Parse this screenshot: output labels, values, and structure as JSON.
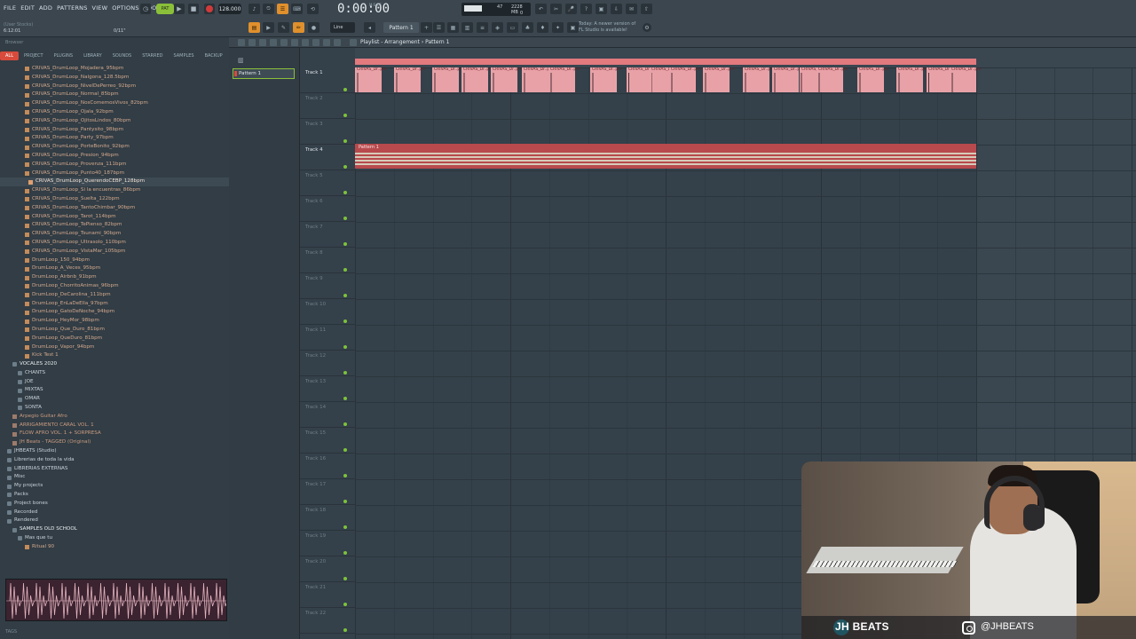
{
  "menu": [
    "FILE",
    "EDIT",
    "ADD",
    "PATTERNS",
    "VIEW",
    "OPTIONS",
    "TOOLS",
    "HELP"
  ],
  "hint": {
    "top": "(User Stocks)",
    "time": "6:12:01",
    "right": "0/11\""
  },
  "transport": {
    "pat_label": "PAT",
    "tempo": "128.000",
    "time": "0:00:00",
    "time_sub": "M:S:CS"
  },
  "cpu": {
    "ram": "2228 MB",
    "cpu": "47",
    "voices": "0"
  },
  "notice": [
    "Today:  A newer version of",
    "FL Studio is available!"
  ],
  "toolbar": {
    "snap": "Line",
    "pattern": "Pattern 1"
  },
  "browser": {
    "header": "Browser",
    "tabs": [
      "ALL",
      "PROJECT",
      "PLUGINS",
      "LIBRARY",
      "SOUNDS",
      "STARRED",
      "SAMPLES",
      "BACKUP"
    ],
    "items": [
      {
        "label": "CRIVAS_DrumLoop_Mojadera_95bpm",
        "kind": "file"
      },
      {
        "label": "CRIVAS_DrumLoop_Nalgona_128.5bpm",
        "kind": "file"
      },
      {
        "label": "CRIVAS_DrumLoop_NivelDePerreo_92bpm",
        "kind": "file"
      },
      {
        "label": "CRIVAS_DrumLoop_Normal_85bpm",
        "kind": "file"
      },
      {
        "label": "CRIVAS_DrumLoop_NosComemosVivos_82bpm",
        "kind": "file"
      },
      {
        "label": "CRIVAS_DrumLoop_Ojala_92bpm",
        "kind": "file"
      },
      {
        "label": "CRIVAS_DrumLoop_OjitosLindos_80bpm",
        "kind": "file"
      },
      {
        "label": "CRIVAS_DrumLoop_Pantysito_98bpm",
        "kind": "file"
      },
      {
        "label": "CRIVAS_DrumLoop_Party_97bpm",
        "kind": "file"
      },
      {
        "label": "CRIVAS_DrumLoop_PorteBonito_92bpm",
        "kind": "file"
      },
      {
        "label": "CRIVAS_DrumLoop_Presion_94bpm",
        "kind": "file"
      },
      {
        "label": "CRIVAS_DrumLoop_Provenza_111bpm",
        "kind": "file"
      },
      {
        "label": "CRIVAS_DrumLoop_Punto40_187bpm",
        "kind": "file"
      },
      {
        "label": "CRIVAS_DrumLoop_QuerendoCEBP_128bpm",
        "kind": "sel"
      },
      {
        "label": "CRIVAS_DrumLoop_Si la encuentras_86bpm",
        "kind": "file"
      },
      {
        "label": "CRIVAS_DrumLoop_Suelta_122bpm",
        "kind": "file"
      },
      {
        "label": "CRIVAS_DrumLoop_TantoChimbar_90bpm",
        "kind": "file"
      },
      {
        "label": "CRIVAS_DrumLoop_Tarot_114bpm",
        "kind": "file"
      },
      {
        "label": "CRIVAS_DrumLoop_TePienso_82bpm",
        "kind": "file"
      },
      {
        "label": "CRIVAS_DrumLoop_Tsunami_90bpm",
        "kind": "file"
      },
      {
        "label": "CRIVAS_DrumLoop_Ultrasolo_110bpm",
        "kind": "file"
      },
      {
        "label": "CRIVAS_DrumLoop_VistaMar_105bpm",
        "kind": "file"
      },
      {
        "label": "DrumLoop_150_94bpm",
        "kind": "file"
      },
      {
        "label": "DrumLoop_A_Veces_95bpm",
        "kind": "file"
      },
      {
        "label": "DrumLoop_Airbnb_91bpm",
        "kind": "file"
      },
      {
        "label": "DrumLoop_ChorritoAnimas_96bpm",
        "kind": "file"
      },
      {
        "label": "DrumLoop_DeCarolina_111bpm",
        "kind": "file"
      },
      {
        "label": "DrumLoop_EnLaDeElla_97bpm",
        "kind": "file"
      },
      {
        "label": "DrumLoop_GatoDeNoche_94bpm",
        "kind": "file"
      },
      {
        "label": "DrumLoop_HeyMor_98bpm",
        "kind": "file"
      },
      {
        "label": "DrumLoop_Que_Duro_81bpm",
        "kind": "file"
      },
      {
        "label": "DrumLoop_QueDuro_81bpm",
        "kind": "file"
      },
      {
        "label": "DrumLoop_Vapor_94bpm",
        "kind": "file"
      },
      {
        "label": "Kick Test 1",
        "kind": "file"
      },
      {
        "label": "VOCALES 2020",
        "kind": "hdr"
      },
      {
        "label": "CHANTS",
        "kind": "sub"
      },
      {
        "label": "JOE",
        "kind": "sub"
      },
      {
        "label": "MIXTAS",
        "kind": "sub"
      },
      {
        "label": "OMAR",
        "kind": "sub"
      },
      {
        "label": "SONTA",
        "kind": "sub"
      },
      {
        "label": "Arpegio Guitar Afro",
        "kind": "proj"
      },
      {
        "label": "ARRIGAMIENTO CARAL VOL. 1",
        "kind": "proj"
      },
      {
        "label": "FLOW AFRO VOL. 1 + SORPRESA",
        "kind": "proj"
      },
      {
        "label": "JH Beats - TAGGED (Original)",
        "kind": "proj"
      },
      {
        "label": "JHBEATS (Studio)",
        "kind": "top"
      },
      {
        "label": "Librerias de toda la vida",
        "kind": "top"
      },
      {
        "label": "LIBRERIAS EXTERNAS",
        "kind": "top"
      },
      {
        "label": "Misc",
        "kind": "top"
      },
      {
        "label": "My projects",
        "kind": "top"
      },
      {
        "label": "Packs",
        "kind": "top"
      },
      {
        "label": "Project bones",
        "kind": "top"
      },
      {
        "label": "Recorded",
        "kind": "top"
      },
      {
        "label": "Rendered",
        "kind": "top"
      },
      {
        "label": "SAMPLES OLD SCHOOL",
        "kind": "hdr"
      },
      {
        "label": "Mas que tu",
        "kind": "sub"
      },
      {
        "label": "Ritual 90",
        "kind": "file"
      }
    ],
    "footer": "TAGS"
  },
  "playlist": {
    "title": "Playlist - Arrangement",
    "pattern_crumb": "Pattern 1",
    "picker_pattern": "Pattern 1",
    "tracks": [
      "Track 1",
      "Track 2",
      "Track 3",
      "Track 4",
      "Track 5",
      "Track 6",
      "Track 7",
      "Track 8",
      "Track 9",
      "Track 10",
      "Track 11",
      "Track 12",
      "Track 13",
      "Track 14",
      "Track 15",
      "Track 16",
      "Track 17",
      "Track 18",
      "Track 19",
      "Track 20",
      "Track 21",
      "Track 22"
    ],
    "audio_clip_label": "CRIVAS_Dr..pm",
    "pattern_clip_label": "Pattern 1",
    "colors": {
      "audio_clip": "#e8a2a7",
      "pattern_clip": "#b84a4d",
      "accent": "#8bbf3a"
    }
  },
  "webcam": {
    "brand": "BEATS",
    "handle": "@JHBEATS"
  }
}
